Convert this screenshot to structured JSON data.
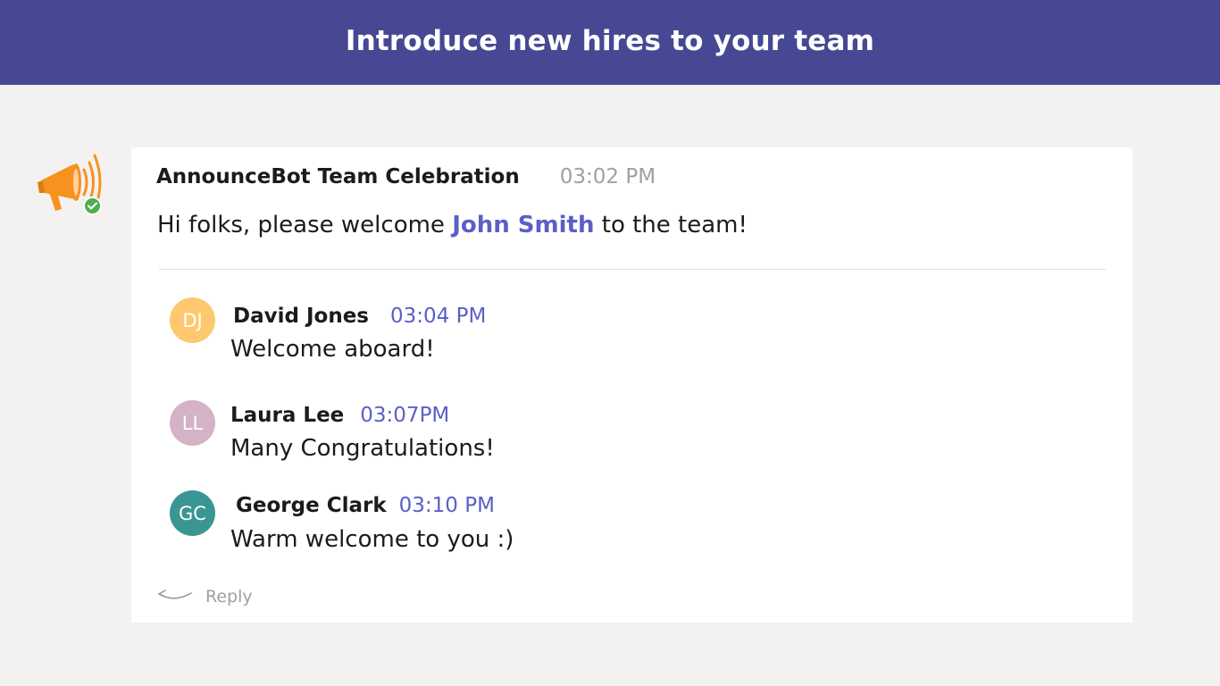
{
  "banner": {
    "title": "Introduce new hires to your team",
    "background": "#464894"
  },
  "post": {
    "author": "AnnounceBot Team Celebration",
    "time": "03:02 PM",
    "body_prefix": "Hi folks, please welcome ",
    "mention": "John Smith",
    "body_suffix": " to the team!",
    "bot_icon": "megaphone-icon",
    "presence": "available",
    "presence_icon": "check-icon"
  },
  "replies": [
    {
      "initials": "DJ",
      "author": "David Jones",
      "time": "03:04 PM",
      "text": "Welcome aboard!",
      "avatar_color": "#fdc86f"
    },
    {
      "initials": "LL",
      "author": "Laura Lee",
      "time": "03:07PM",
      "text": "Many Congratulations!",
      "avatar_color": "#d4b3c7"
    },
    {
      "initials": "GC",
      "author": "George Clark",
      "time": "03:10 PM",
      "text": "Warm welcome to you :)",
      "avatar_color": "#3a9692"
    }
  ],
  "reply_action": {
    "label": "Reply",
    "icon": "reply-arrow-icon"
  },
  "colors": {
    "accent": "#5b5fc7",
    "page_background": "#f3f2f1",
    "card_background": "#ffffff",
    "presence_green": "#4caf50",
    "bot_orange": "#f7921e"
  }
}
